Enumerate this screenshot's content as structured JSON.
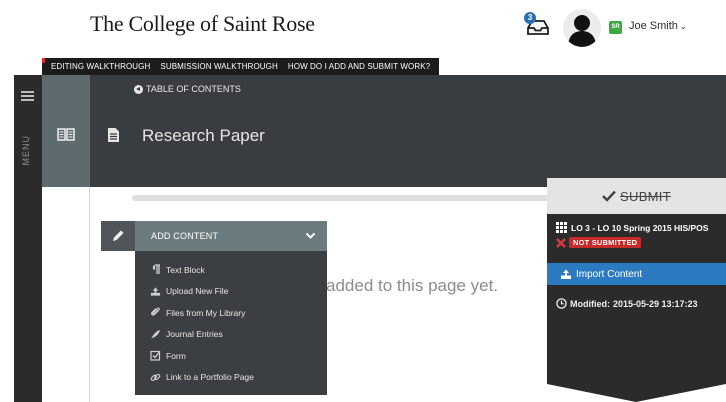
{
  "header": {
    "college_name": "The College of Saint Rose",
    "notification_count": "3",
    "user_initials": "SR",
    "user_name": "Joe Smith"
  },
  "walkthrough_bar": {
    "links": [
      "EDITING WALKTHROUGH",
      "SUBMISSION WALKTHROUGH",
      "HOW DO I ADD AND SUBMIT WORK?"
    ]
  },
  "menu": {
    "label": "MENU"
  },
  "page": {
    "toc_label": "TABLE OF CONTENTS",
    "title": "Research Paper",
    "empty_message": "added to this page yet."
  },
  "add_content": {
    "label": "ADD CONTENT",
    "items": [
      {
        "label": "Text Block",
        "icon": "paragraph-icon"
      },
      {
        "label": "Upload New File",
        "icon": "upload-icon"
      },
      {
        "label": "Files from My Library",
        "icon": "paperclip-icon"
      },
      {
        "label": "Journal Entries",
        "icon": "quill-icon"
      },
      {
        "label": "Form",
        "icon": "checkbox-icon"
      },
      {
        "label": "Link to a Portfolio Page",
        "icon": "link-icon"
      }
    ]
  },
  "submit_panel": {
    "submit_label": "SUBMIT",
    "assignment": "LO 3 - LO 10 Spring 2015 HIS/POS",
    "status": "NOT SUBMITTED",
    "import_label": "Import Content",
    "modified_label": "Modified:",
    "modified_value": "2015-05-29 13:17:23"
  },
  "colors": {
    "dark_header": "#3a3d3f",
    "teal_accent": "#5d6a6e",
    "import_blue": "#2c7bc0",
    "status_red": "#c62b2b",
    "user_green": "#3ea845"
  }
}
